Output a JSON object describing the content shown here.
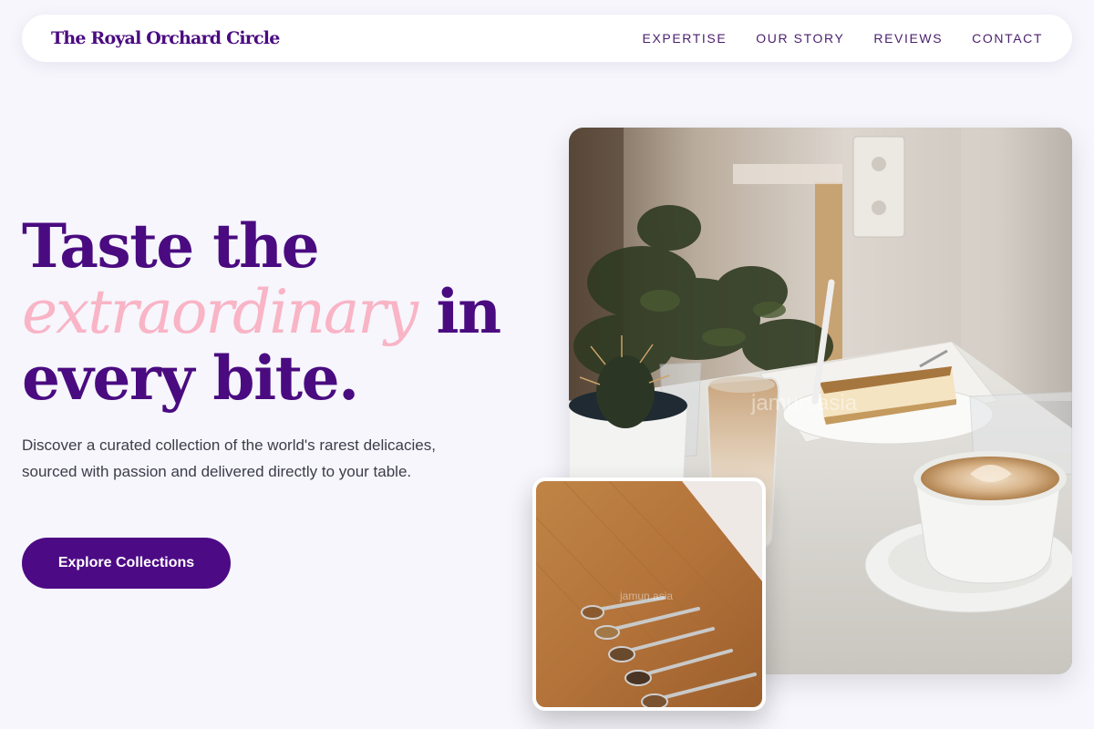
{
  "brand": {
    "name": "The Royal Orchard Circle"
  },
  "nav": {
    "items": [
      {
        "label": "EXPERTISE"
      },
      {
        "label": "OUR STORY"
      },
      {
        "label": "REVIEWS"
      },
      {
        "label": "CONTACT"
      }
    ]
  },
  "hero": {
    "title_line1": "Taste the",
    "title_accent": "extraordinary",
    "title_after_accent": " in",
    "title_line3": "every bite.",
    "description": "Discover a curated collection of the world's rarest delicacies, sourced with passion and delivered directly to your table.",
    "cta_label": "Explore Collections"
  },
  "images": {
    "main_watermark": "jamun.asia",
    "inset_watermark": "jamun.asia"
  },
  "colors": {
    "primary": "#4a0b80",
    "accent": "#f9b4c6",
    "background": "#f6f6fc",
    "button": "#4d0a85"
  }
}
